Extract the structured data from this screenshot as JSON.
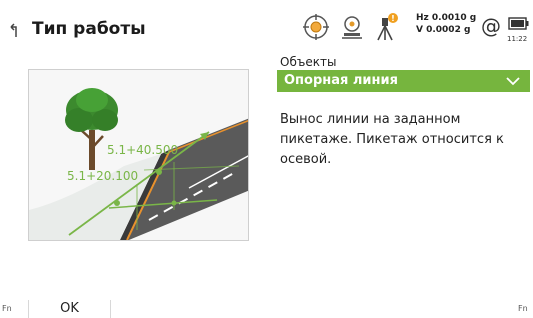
{
  "header": {
    "title": "Тип работы",
    "icons": [
      "back-icon",
      "target-prism-icon",
      "measure-mode-icon",
      "instrument-warning-icon",
      "at-icon",
      "battery-icon"
    ],
    "hz": "Hz 0.0010 g",
    "v": "V  0.0002 g",
    "at_symbol": "@",
    "time": "11:22"
  },
  "illustration": {
    "label_top": "5.1+40.500",
    "label_bottom": "5.1+20.100"
  },
  "form": {
    "objects_label": "Объекты",
    "objects_value": "Опорная линия",
    "description": "Вынос линии на заданном пикетаже. Пикетаж относится к осевой."
  },
  "softkeys": {
    "fn_left": "Fn",
    "ok_label": "OK",
    "fn_right": "Fn"
  },
  "colors": {
    "accent_green": "#76b53e",
    "line_green": "#7ab648",
    "road_orange": "#e8912d"
  }
}
